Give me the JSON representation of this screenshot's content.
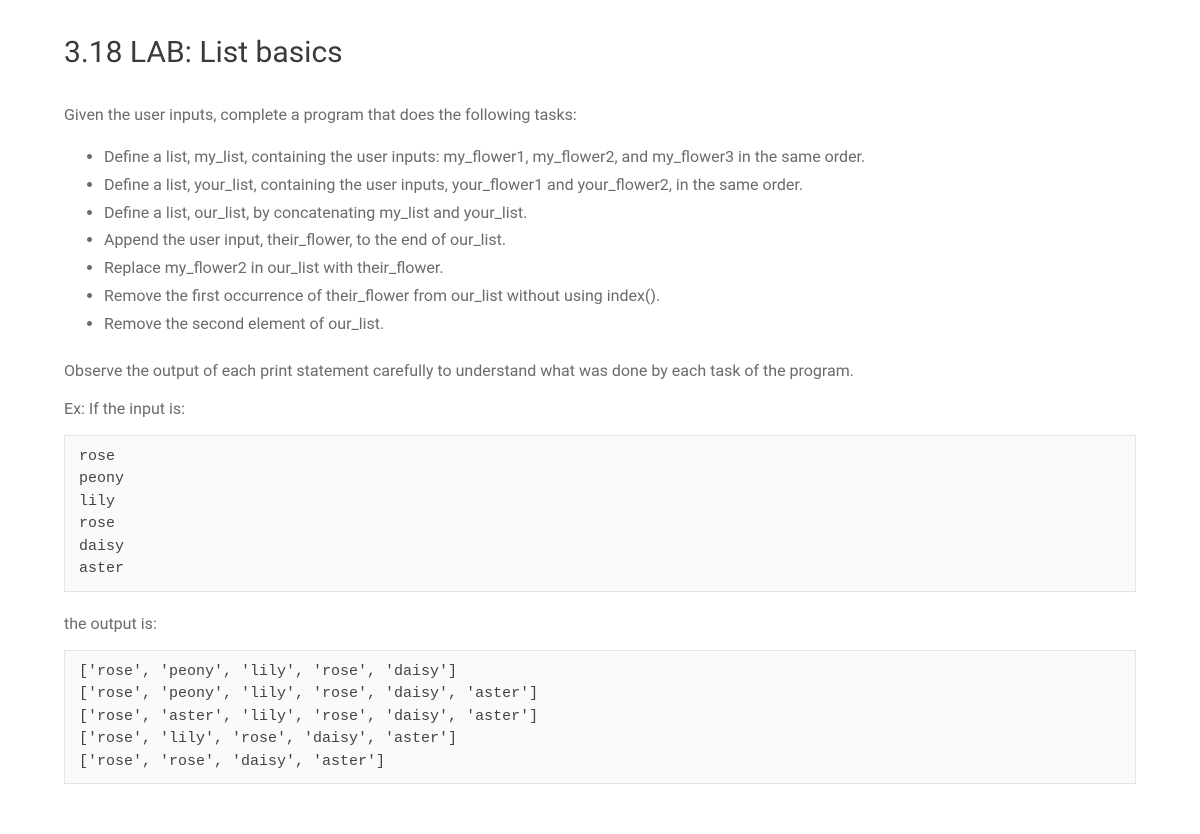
{
  "title": "3.18 LAB: List basics",
  "intro": "Given the user inputs, complete a program that does the following tasks:",
  "tasks": [
    "Define a list, my_list, containing the user inputs: my_flower1, my_flower2, and my_flower3 in the same order.",
    "Define a list, your_list, containing the user inputs, your_flower1 and your_flower2, in the same order.",
    "Define a list, our_list, by concatenating my_list and your_list.",
    "Append the user input, their_flower, to the end of our_list.",
    "Replace my_flower2 in our_list with their_flower.",
    "Remove the first occurrence of their_flower from our_list without using index().",
    "Remove the second element of our_list."
  ],
  "observe": "Observe the output of each print statement carefully to understand what was done by each task of the program.",
  "example_label": "Ex: If the input is:",
  "input_block": "rose\npeony\nlily\nrose\ndaisy\naster",
  "output_label": "the output is:",
  "output_block": "['rose', 'peony', 'lily', 'rose', 'daisy']\n['rose', 'peony', 'lily', 'rose', 'daisy', 'aster']\n['rose', 'aster', 'lily', 'rose', 'daisy', 'aster']\n['rose', 'lily', 'rose', 'daisy', 'aster']\n['rose', 'rose', 'daisy', 'aster']"
}
